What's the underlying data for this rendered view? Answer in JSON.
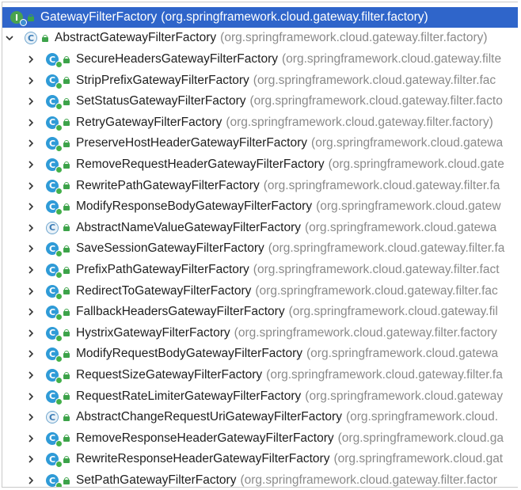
{
  "root": {
    "name": "GatewayFilterFactory",
    "package": "(org.springframework.cloud.gateway.filter.factory)"
  },
  "parent": {
    "name": "AbstractGatewayFilterFactory",
    "package": "(org.springframework.cloud.gateway.filter.factory)"
  },
  "children": [
    {
      "name": "SecureHeadersGatewayFilterFactory",
      "package": "(org.springframework.cloud.gateway.filte",
      "abstract": false
    },
    {
      "name": "StripPrefixGatewayFilterFactory",
      "package": "(org.springframework.cloud.gateway.filter.fac",
      "abstract": false
    },
    {
      "name": "SetStatusGatewayFilterFactory",
      "package": "(org.springframework.cloud.gateway.filter.facto",
      "abstract": false
    },
    {
      "name": "RetryGatewayFilterFactory",
      "package": "(org.springframework.cloud.gateway.filter.factory)",
      "abstract": false
    },
    {
      "name": "PreserveHostHeaderGatewayFilterFactory",
      "package": "(org.springframework.cloud.gatewa",
      "abstract": false
    },
    {
      "name": "RemoveRequestHeaderGatewayFilterFactory",
      "package": "(org.springframework.cloud.gate",
      "abstract": false
    },
    {
      "name": "RewritePathGatewayFilterFactory",
      "package": "(org.springframework.cloud.gateway.filter.fa",
      "abstract": false
    },
    {
      "name": "ModifyResponseBodyGatewayFilterFactory",
      "package": "(org.springframework.cloud.gatew",
      "abstract": false
    },
    {
      "name": "AbstractNameValueGatewayFilterFactory",
      "package": "(org.springframework.cloud.gatewa",
      "abstract": true
    },
    {
      "name": "SaveSessionGatewayFilterFactory",
      "package": "(org.springframework.cloud.gateway.filter.fa",
      "abstract": false
    },
    {
      "name": "PrefixPathGatewayFilterFactory",
      "package": "(org.springframework.cloud.gateway.filter.fact",
      "abstract": false
    },
    {
      "name": "RedirectToGatewayFilterFactory",
      "package": "(org.springframework.cloud.gateway.filter.fac",
      "abstract": false
    },
    {
      "name": "FallbackHeadersGatewayFilterFactory",
      "package": "(org.springframework.cloud.gateway.fil",
      "abstract": false
    },
    {
      "name": "HystrixGatewayFilterFactory",
      "package": "(org.springframework.cloud.gateway.filter.factory",
      "abstract": false
    },
    {
      "name": "ModifyRequestBodyGatewayFilterFactory",
      "package": "(org.springframework.cloud.gatewa",
      "abstract": false
    },
    {
      "name": "RequestSizeGatewayFilterFactory",
      "package": "(org.springframework.cloud.gateway.filter.fa",
      "abstract": false
    },
    {
      "name": "RequestRateLimiterGatewayFilterFactory",
      "package": "(org.springframework.cloud.gateway",
      "abstract": false
    },
    {
      "name": "AbstractChangeRequestUriGatewayFilterFactory",
      "package": "(org.springframework.cloud.",
      "abstract": true
    },
    {
      "name": "RemoveResponseHeaderGatewayFilterFactory",
      "package": "(org.springframework.cloud.ga",
      "abstract": false
    },
    {
      "name": "RewriteResponseHeaderGatewayFilterFactory",
      "package": "(org.springframework.cloud.gat",
      "abstract": false
    },
    {
      "name": "SetPathGatewayFilterFactory",
      "package": "(org.springframework.cloud.gateway.filter.factor",
      "abstract": false
    }
  ],
  "colors": {
    "selection": "#2f65ca",
    "class_icon": "#2f9bd7",
    "access_lock": "#3da34a",
    "package_text": "#8a8a8a"
  },
  "icons": {
    "root": "interface-icon",
    "class": "class-icon",
    "abstract_class": "abstract-class-icon",
    "access": "public-lock-icon",
    "collapsed": "chevron-right-icon",
    "expanded": "chevron-down-icon"
  }
}
